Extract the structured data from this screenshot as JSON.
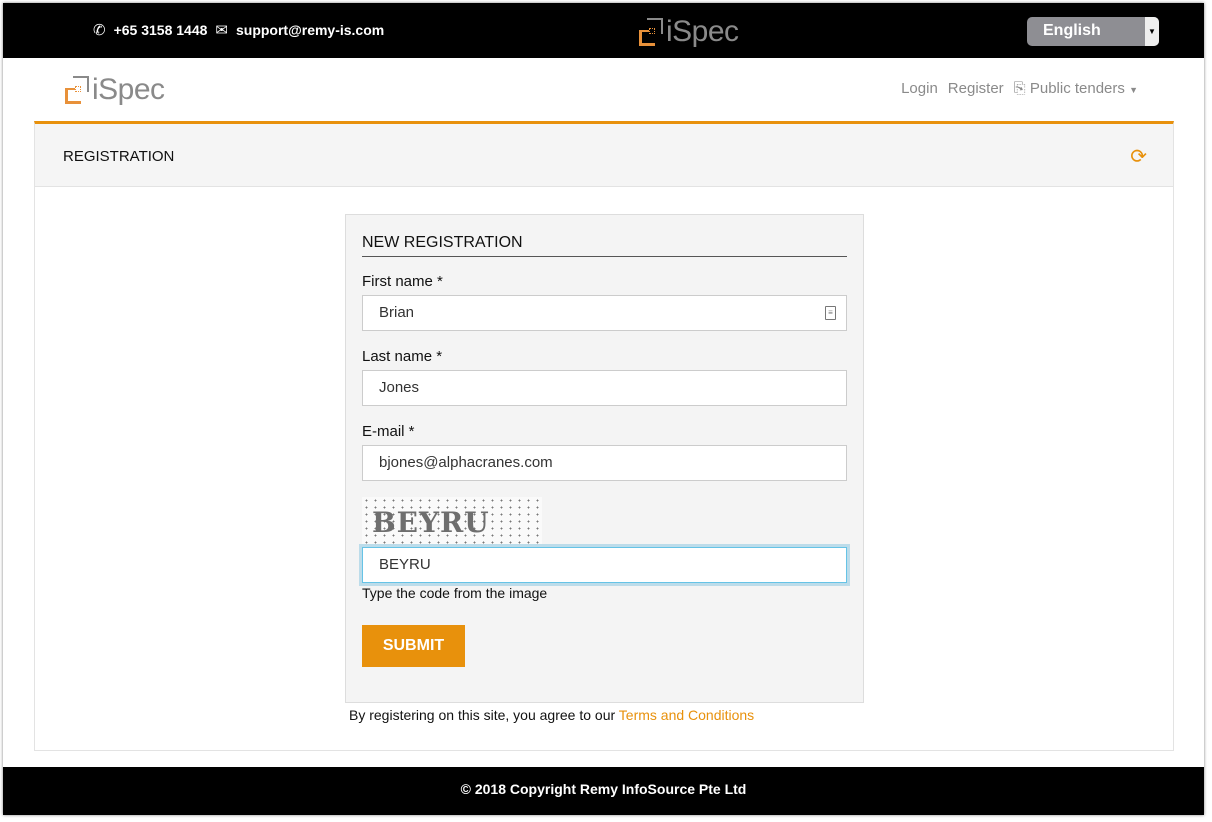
{
  "topbar": {
    "phone_icon": "phone-icon",
    "phone": "+65 3158 1448",
    "email_icon": "envelope-icon",
    "email": "support@remy-is.com",
    "logo_text": "iSpec",
    "language": "English"
  },
  "nav": {
    "logo_text": "iSpec",
    "login": "Login",
    "register": "Register",
    "tenders_icon": "document-arrow-icon",
    "public_tenders": "Public tenders"
  },
  "panel": {
    "title": "REGISTRATION",
    "refresh_icon": "refresh-icon"
  },
  "form": {
    "title": "NEW REGISTRATION",
    "first_name_label": "First name *",
    "first_name": "Brian",
    "last_name_label": "Last name *",
    "last_name": "Jones",
    "email_label": "E-mail *",
    "email": "bjones@alphacranes.com",
    "captcha_text": "BEYRU",
    "captcha_value": "BEYRU",
    "captcha_hint": "Type the code from the image",
    "submit": "SUBMIT"
  },
  "agreement": {
    "text": "By registering on this site, you agree to our ",
    "link": "Terms and Conditions"
  },
  "footer": {
    "copyright": "© 2018 Copyright  Remy InfoSource Pte Ltd"
  },
  "colors": {
    "accent": "#e8910c",
    "topbar": "#000000"
  }
}
